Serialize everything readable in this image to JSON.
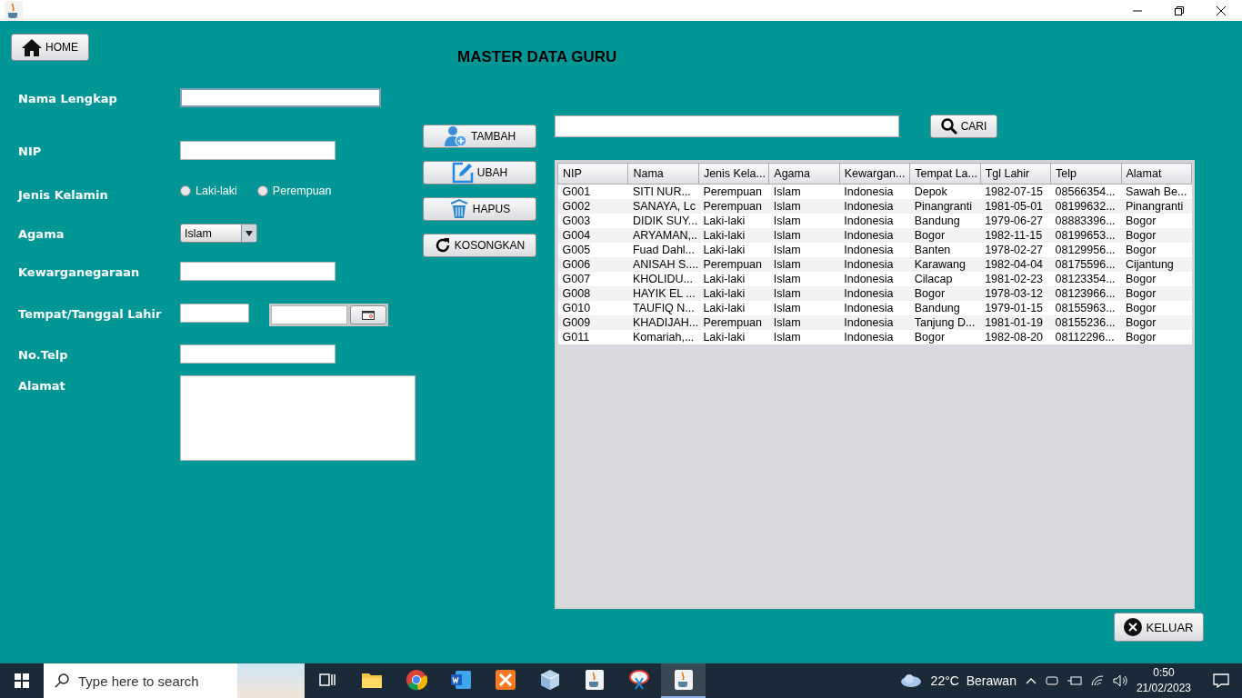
{
  "window": {
    "title": "MASTER DATA GURU"
  },
  "home_button": {
    "label": "HOME"
  },
  "form": {
    "fields": [
      {
        "kind": "text",
        "label": "Nama Lengkap",
        "focused": true
      },
      {
        "kind": "text",
        "label": "NIP",
        "focused": false
      },
      {
        "kind": "radio",
        "label": "Jenis Kelamin",
        "options": [
          {
            "label": "Laki-laki",
            "selected": false
          },
          {
            "label": "Perempuan",
            "selected": false
          }
        ]
      },
      {
        "kind": "select",
        "label": "Agama",
        "value": "Islam"
      },
      {
        "kind": "text",
        "label": "Kewarganegaraan",
        "focused": false
      },
      {
        "kind": "place_date",
        "label": "Tempat/Tanggal Lahir"
      },
      {
        "kind": "text",
        "label": "No.Telp",
        "focused": false
      },
      {
        "kind": "textarea",
        "label": "Alamat"
      }
    ]
  },
  "actions": [
    {
      "kind": "add",
      "label": "TAMBAH"
    },
    {
      "kind": "edit",
      "label": "UBAH"
    },
    {
      "kind": "delete",
      "label": "HAPUS"
    },
    {
      "kind": "reset",
      "label": "KOSONGKAN"
    }
  ],
  "search": {
    "button": "CARI"
  },
  "table": {
    "columns": [
      "NIP",
      "Nama",
      "Jenis Kela...",
      "Agama",
      "Kewargan...",
      "Tempat La...",
      "Tgl Lahir",
      "Telp",
      "Alamat"
    ],
    "rows": [
      [
        "G001",
        "SITI NUR...",
        "Perempuan",
        "Islam",
        "Indonesia",
        "Depok",
        "1982-07-15",
        "08566354...",
        "Sawah Be..."
      ],
      [
        "G002",
        "SANAYA, Lc",
        "Perempuan",
        "Islam",
        "Indonesia",
        "Pinangranti",
        "1981-05-01",
        "08199632...",
        "Pinangranti"
      ],
      [
        "G003",
        "DIDIK SUY...",
        "Laki-laki",
        "Islam",
        "Indonesia",
        "Bandung",
        "1979-06-27",
        "08883396...",
        "Bogor"
      ],
      [
        "G004",
        "ARYAMAN,...",
        "Laki-laki",
        "Islam",
        "Indonesia",
        "Bogor",
        "1982-11-15",
        "08199653...",
        "Bogor"
      ],
      [
        "G005",
        "Fuad Dahl...",
        "Laki-laki",
        "Islam",
        "Indonesia",
        "Banten",
        "1978-02-27",
        "08129956...",
        "Bogor"
      ],
      [
        "G006",
        "ANISAH S....",
        "Perempuan",
        "Islam",
        "Indonesia",
        "Karawang",
        "1982-04-04",
        "08175596...",
        "Cijantung"
      ],
      [
        "G007",
        "KHOLIDU...",
        "Laki-laki",
        "Islam",
        "Indonesia",
        "Cilacap",
        "1981-02-23",
        "08123354...",
        "Bogor"
      ],
      [
        "G008",
        "HAYIK EL ...",
        "Laki-laki",
        "Islam",
        "Indonesia",
        "Bogor",
        "1978-03-12",
        "08123966...",
        "Bogor"
      ],
      [
        "G010",
        "TAUFIQ N...",
        "Laki-laki",
        "Islam",
        "Indonesia",
        "Bandung",
        "1979-01-15",
        "08155963...",
        "Bogor"
      ],
      [
        "G009",
        "KHADIJAH...",
        "Perempuan",
        "Islam",
        "Indonesia",
        "Tanjung D...",
        "1981-01-19",
        "08155236...",
        "Bogor"
      ],
      [
        "G011",
        "Komariah,...",
        "Laki-laki",
        "Islam",
        "Indonesia",
        "Bogor",
        "1982-08-20",
        "08112296...",
        "Bogor"
      ]
    ]
  },
  "exit_button": {
    "label": "KELUAR"
  },
  "taskbar": {
    "search_placeholder": "Type here to search",
    "apps": [
      {
        "kind": "taskview",
        "selected": false
      },
      {
        "kind": "folder",
        "selected": false
      },
      {
        "kind": "browser",
        "selected": false
      },
      {
        "kind": "word",
        "selected": false
      },
      {
        "kind": "xampp",
        "selected": false
      },
      {
        "kind": "cube",
        "selected": false
      },
      {
        "kind": "java",
        "selected": false
      },
      {
        "kind": "snip",
        "selected": false
      },
      {
        "kind": "java",
        "selected": true
      }
    ],
    "weather": "22°C  Berawan",
    "time": "0:50",
    "date": "21/02/2023"
  }
}
